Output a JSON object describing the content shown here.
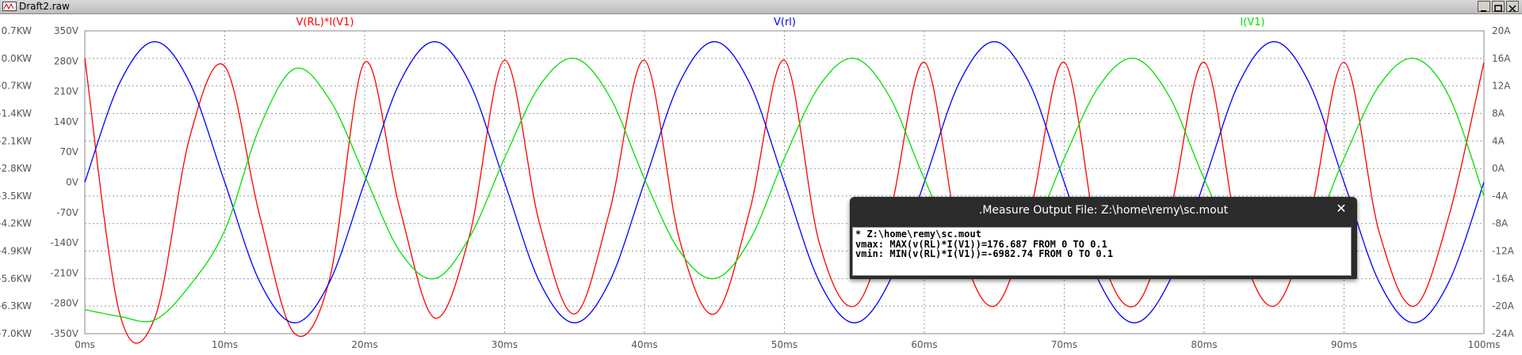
{
  "window": {
    "title": "Draft2.raw"
  },
  "measure_dialog": {
    "title": ".Measure Output File: Z:\\home\\remy\\sc.mout",
    "lines": [
      "* Z:\\home\\remy\\sc.mout",
      "vmax: MAX(v(RL)*I(V1))=176.687 FROM 0 TO 0.1",
      "vmin: MIN(v(RL)*I(V1))=-6982.74 FROM 0 TO 0.1"
    ]
  },
  "chart_data": {
    "type": "line",
    "x": [
      0,
      2.5,
      5,
      7.5,
      10,
      12.5,
      15,
      17.5,
      20,
      22.5,
      25,
      27.5,
      30,
      32.5,
      35,
      37.5,
      40,
      42.5,
      45,
      47.5,
      50,
      52.5,
      55,
      57.5,
      60,
      62.5,
      65,
      67.5,
      70,
      72.5,
      75,
      77.5,
      80,
      82.5,
      85,
      87.5,
      90,
      92.5,
      95,
      97.5,
      100
    ],
    "x_unit": "ms",
    "xlim": [
      0,
      100
    ],
    "x_ticks": [
      "0ms",
      "10ms",
      "20ms",
      "30ms",
      "40ms",
      "50ms",
      "60ms",
      "70ms",
      "80ms",
      "90ms",
      "100ms"
    ],
    "y_left_kw_ticks": [
      "0.7KW",
      "0.0KW",
      "-0.7KW",
      "-1.4KW",
      "-2.1KW",
      "-2.8KW",
      "-3.5KW",
      "-4.2KW",
      "-4.9KW",
      "-5.6KW",
      "-6.3KW",
      "-7.0KW"
    ],
    "y_left_v_ticks": [
      "350V",
      "280V",
      "210V",
      "140V",
      "70V",
      "0V",
      "-70V",
      "-140V",
      "-210V",
      "-280V",
      "-350V"
    ],
    "y_right_ticks": [
      "20A",
      "16A",
      "12A",
      "8A",
      "4A",
      "0A",
      "-4A",
      "-8A",
      "-12A",
      "-16A",
      "-20A",
      "-24A"
    ],
    "ylim_power_kw": [
      -7.0,
      0.7
    ],
    "ylim_voltage": [
      -350,
      350
    ],
    "ylim_current": [
      -24,
      20
    ],
    "series": [
      {
        "name": "V(RL)*I(V1)",
        "color": "#ff0000",
        "axis": "power_kw",
        "values": [
          0.0,
          -6.5,
          -6.6,
          -2.0,
          -0.2,
          -4.0,
          -7.0,
          -5.6,
          -0.1,
          -3.8,
          -6.6,
          -4.5,
          -0.05,
          -4.2,
          -6.5,
          -3.9,
          -0.05,
          -4.6,
          -6.5,
          -3.9,
          -0.05,
          -4.7,
          -6.3,
          -4.0,
          -0.1,
          -4.6,
          -6.3,
          -4.0,
          -0.1,
          -4.8,
          -6.3,
          -4.0,
          -0.1,
          -4.6,
          -6.3,
          -4.1,
          -0.1,
          -4.4,
          -6.3,
          -4.0,
          -0.1
        ]
      },
      {
        "name": "V(rl)",
        "color": "#0000ff",
        "axis": "voltage",
        "values": [
          0,
          230,
          325,
          230,
          0,
          -230,
          -325,
          -230,
          0,
          230,
          325,
          230,
          0,
          -230,
          -325,
          -230,
          0,
          230,
          325,
          230,
          0,
          -230,
          -325,
          -230,
          0,
          230,
          325,
          230,
          0,
          -230,
          -325,
          -230,
          0,
          230,
          325,
          230,
          0,
          -230,
          -325,
          -230,
          0
        ]
      },
      {
        "name": "I(V1)",
        "color": "#00e000",
        "axis": "current",
        "values": [
          -20.5,
          -21.5,
          -22.0,
          -17.0,
          -9.0,
          6.0,
          14.5,
          10.0,
          -1.0,
          -12.0,
          -16.0,
          -10.0,
          1.5,
          12.0,
          16.0,
          10.5,
          -1.5,
          -12.0,
          -16.0,
          -10.5,
          1.5,
          12.0,
          16.0,
          10.5,
          -1.5,
          -12.0,
          -16.0,
          -10.5,
          1.5,
          12.0,
          16.0,
          10.5,
          -1.5,
          -12.0,
          -16.0,
          -10.5,
          1.5,
          12.0,
          16.0,
          10.5,
          -4.0
        ]
      }
    ],
    "grid": true
  }
}
